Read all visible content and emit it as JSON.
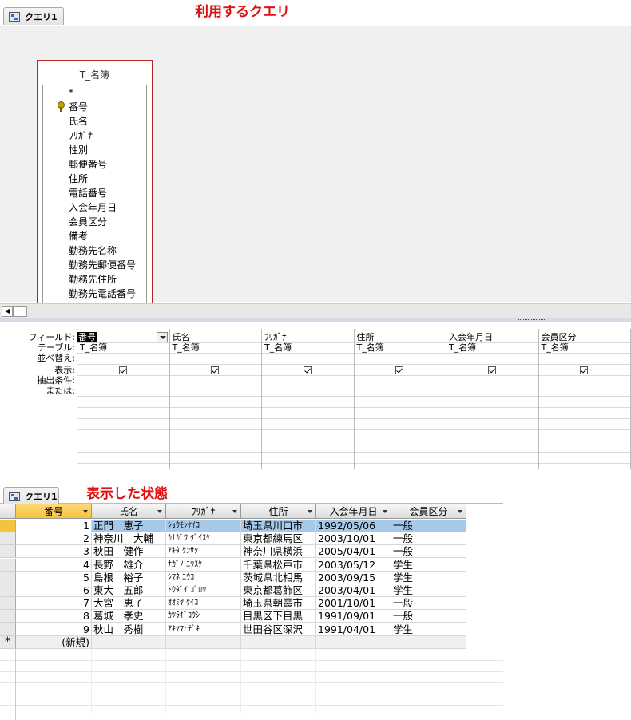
{
  "design": {
    "tab_label": "クエリ1",
    "annotation": "利用するクエリ",
    "table": {
      "name": "T_名簿",
      "fields": [
        "*",
        "番号",
        "氏名",
        "ﾌﾘｶﾞﾅ",
        "性別",
        "郵便番号",
        "住所",
        "電話番号",
        "入会年月日",
        "会員区分",
        "備考",
        "勤務先名称",
        "勤務先郵便番号",
        "勤務先住所",
        "勤務先電話番号"
      ],
      "primary_key": "番号"
    }
  },
  "qbe": {
    "row_labels": [
      "フィールド:",
      "テーブル:",
      "並べ替え:",
      "表示:",
      "抽出条件:",
      "または:"
    ],
    "columns": [
      {
        "field": "番号",
        "table": "T_名簿",
        "show": true
      },
      {
        "field": "氏名",
        "table": "T_名簿",
        "show": true
      },
      {
        "field": "ﾌﾘｶﾞﾅ",
        "table": "T_名簿",
        "show": true
      },
      {
        "field": "住所",
        "table": "T_名簿",
        "show": true
      },
      {
        "field": "入会年月日",
        "table": "T_名簿",
        "show": true
      },
      {
        "field": "会員区分",
        "table": "T_名簿",
        "show": true
      }
    ]
  },
  "datasheet": {
    "tab_label": "クエリ1",
    "annotation": "表示した状態",
    "headers": [
      "番号",
      "氏名",
      "ﾌﾘｶﾞﾅ",
      "住所",
      "入会年月日",
      "会員区分"
    ],
    "rows": [
      [
        "1",
        "正門　恵子",
        "ｼｮｳﾓﾝｹｲｺ",
        "埼玉県川口市",
        "1992/05/06",
        "一般"
      ],
      [
        "2",
        "神奈川　大輔",
        "ｶﾅｶﾞﾜ ﾀﾞｲｽｹ",
        "東京都練馬区",
        "2003/10/01",
        "一般"
      ],
      [
        "3",
        "秋田　健作",
        "ｱｷﾀ ｹﾝｻｸ",
        "神奈川県横浜",
        "2005/04/01",
        "一般"
      ],
      [
        "4",
        "長野　雄介",
        "ﾅｶﾞﾉ ﾕｳｽｹ",
        "千葉県松戸市",
        "2003/05/12",
        "学生"
      ],
      [
        "5",
        "島根　裕子",
        "ｼﾏﾈ ﾕｳｺ",
        "茨城県北相馬",
        "2003/09/15",
        "学生"
      ],
      [
        "6",
        "東大　五郎",
        "ﾄｳﾀﾞｲ ｺﾞﾛｳ",
        "東京都葛飾区",
        "2003/04/01",
        "学生"
      ],
      [
        "7",
        "大宮　恵子",
        "ｵｵﾐﾔ ｹｲｺ",
        "埼玉県朝霞市",
        "2001/10/01",
        "一般"
      ],
      [
        "8",
        "葛城　孝史",
        "ｶﾂﾗｷﾞｺｳｼ",
        "目黒区下目黒",
        "1991/09/01",
        "一般"
      ],
      [
        "9",
        "秋山　秀樹",
        "ｱｷﾔﾏﾋﾃﾞｷ",
        "世田谷区深沢",
        "1991/04/01",
        "学生"
      ]
    ],
    "new_row_marker": "*",
    "new_row_label": "(新規)"
  }
}
